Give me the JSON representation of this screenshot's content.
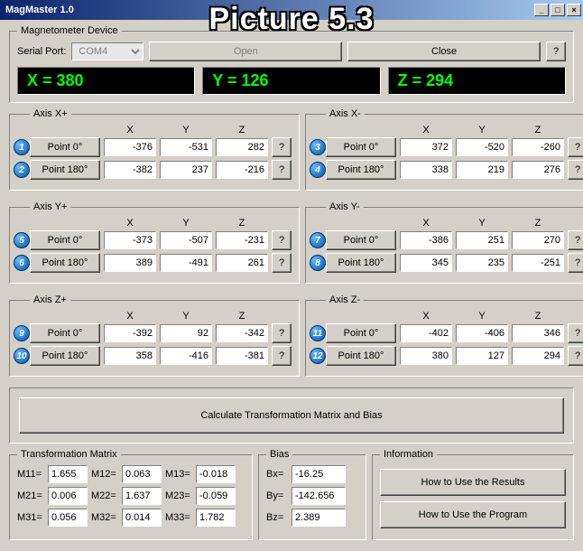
{
  "overlay": "Picture 5.3",
  "window": {
    "title": "MagMaster 1.0"
  },
  "device": {
    "legend": "Magnetometer Device",
    "serial_label": "Serial Port:",
    "serial_value": "COM4",
    "open": "Open",
    "close": "Close",
    "q": "?"
  },
  "readout": {
    "x": "X = 380",
    "y": "Y = 126",
    "z": "Z = 294"
  },
  "cols": {
    "x": "X",
    "y": "Y",
    "z": "Z"
  },
  "point0": "Point 0°",
  "point180": "Point 180°",
  "q": "?",
  "axes": {
    "xp": {
      "legend": "Axis X+",
      "b1": "1",
      "b2": "2",
      "p0": {
        "x": "-376",
        "y": "-531",
        "z": "282"
      },
      "p180": {
        "x": "-382",
        "y": "237",
        "z": "-216"
      }
    },
    "xm": {
      "legend": "Axis X-",
      "b1": "3",
      "b2": "4",
      "p0": {
        "x": "372",
        "y": "-520",
        "z": "-260"
      },
      "p180": {
        "x": "338",
        "y": "219",
        "z": "276"
      }
    },
    "yp": {
      "legend": "Axis Y+",
      "b1": "5",
      "b2": "6",
      "p0": {
        "x": "-373",
        "y": "-507",
        "z": "-231"
      },
      "p180": {
        "x": "389",
        "y": "-491",
        "z": "261"
      }
    },
    "ym": {
      "legend": "Axis Y-",
      "b1": "7",
      "b2": "8",
      "p0": {
        "x": "-386",
        "y": "251",
        "z": "270"
      },
      "p180": {
        "x": "345",
        "y": "235",
        "z": "-251"
      }
    },
    "zp": {
      "legend": "Axis Z+",
      "b1": "9",
      "b2": "10",
      "p0": {
        "x": "-392",
        "y": "92",
        "z": "-342"
      },
      "p180": {
        "x": "358",
        "y": "-416",
        "z": "-381"
      }
    },
    "zm": {
      "legend": "Axis Z-",
      "b1": "11",
      "b2": "12",
      "p0": {
        "x": "-402",
        "y": "-406",
        "z": "346"
      },
      "p180": {
        "x": "380",
        "y": "127",
        "z": "294"
      }
    }
  },
  "calc": "Calculate Transformation Matrix and Bias",
  "matrix": {
    "legend": "Transformation Matrix",
    "m11l": "M11=",
    "m11": "1.655",
    "m12l": "M12=",
    "m12": "0.063",
    "m13l": "M13=",
    "m13": "-0.018",
    "m21l": "M21=",
    "m21": "0.006",
    "m22l": "M22=",
    "m22": "1.637",
    "m23l": "M23=",
    "m23": "-0.059",
    "m31l": "M31=",
    "m31": "0.056",
    "m32l": "M32=",
    "m32": "0.014",
    "m33l": "M33=",
    "m33": "1.782"
  },
  "bias": {
    "legend": "Bias",
    "bxl": "Bx=",
    "bx": "-16.25",
    "byl": "By=",
    "by": "-142.656",
    "bzl": "Bz=",
    "bz": "2.389"
  },
  "info": {
    "legend": "Information",
    "results": "How to Use the Results",
    "program": "How to Use the Program"
  }
}
